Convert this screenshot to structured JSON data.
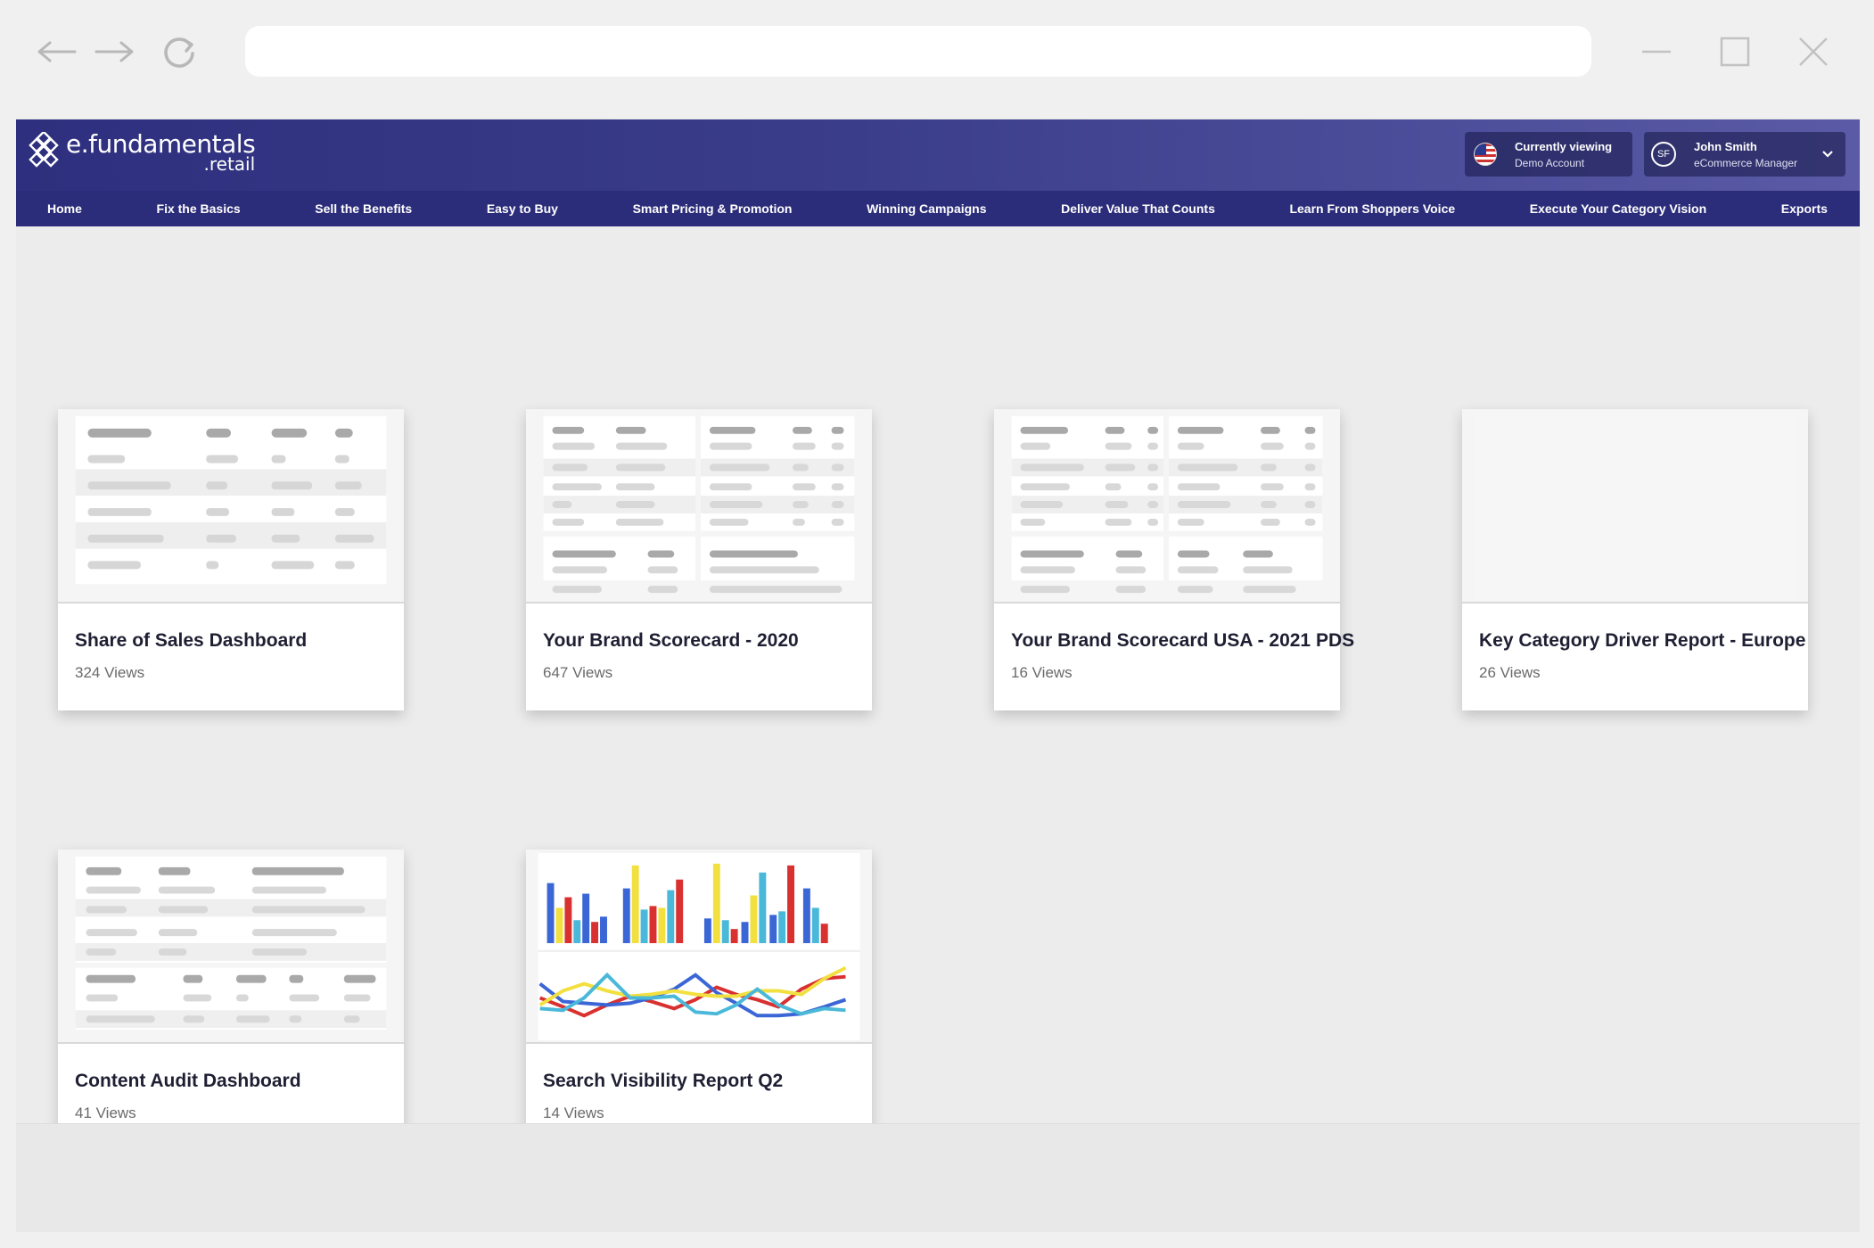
{
  "browser": {
    "back_icon": "arrow-left-icon",
    "forward_icon": "arrow-right-icon",
    "reload_icon": "reload-icon",
    "address": ""
  },
  "header": {
    "logo_name": "e.fundamentals",
    "logo_sub": ".retail",
    "viewing_title": "Currently viewing",
    "viewing_account": "Demo Account",
    "user_initials": "SF",
    "user_name": "John Smith",
    "user_role": "eCommerce Manager"
  },
  "menu": [
    {
      "label": "Home"
    },
    {
      "label": "Fix the Basics"
    },
    {
      "label": "Sell the Benefits"
    },
    {
      "label": "Easy to Buy"
    },
    {
      "label": "Smart Pricing & Promotion"
    },
    {
      "label": "Winning Campaigns"
    },
    {
      "label": "Deliver Value That Counts"
    },
    {
      "label": "Learn From Shoppers Voice"
    },
    {
      "label": "Execute Your Category Vision"
    },
    {
      "label": "Exports"
    }
  ],
  "cards": [
    {
      "title": "Share of Sales Dashboard",
      "views": "324 Views"
    },
    {
      "title": "Your Brand Scorecard - 2020",
      "views": "647 Views"
    },
    {
      "title": "Your Brand Scorecard USA - 2021 PDS",
      "views": "16 Views"
    },
    {
      "title": "Key Category Driver Report - Europe",
      "views": "26 Views"
    },
    {
      "title": "Content Audit Dashboard",
      "views": "41 Views"
    },
    {
      "title": "Search Visibility Report Q2",
      "views": "14 Views"
    }
  ],
  "colors": {
    "header_dark": "#2c2d7a",
    "bar_blue": "#3a66d6",
    "bar_yellow": "#f2e040",
    "bar_cyan": "#4ab8d8",
    "bar_red": "#d93030"
  }
}
